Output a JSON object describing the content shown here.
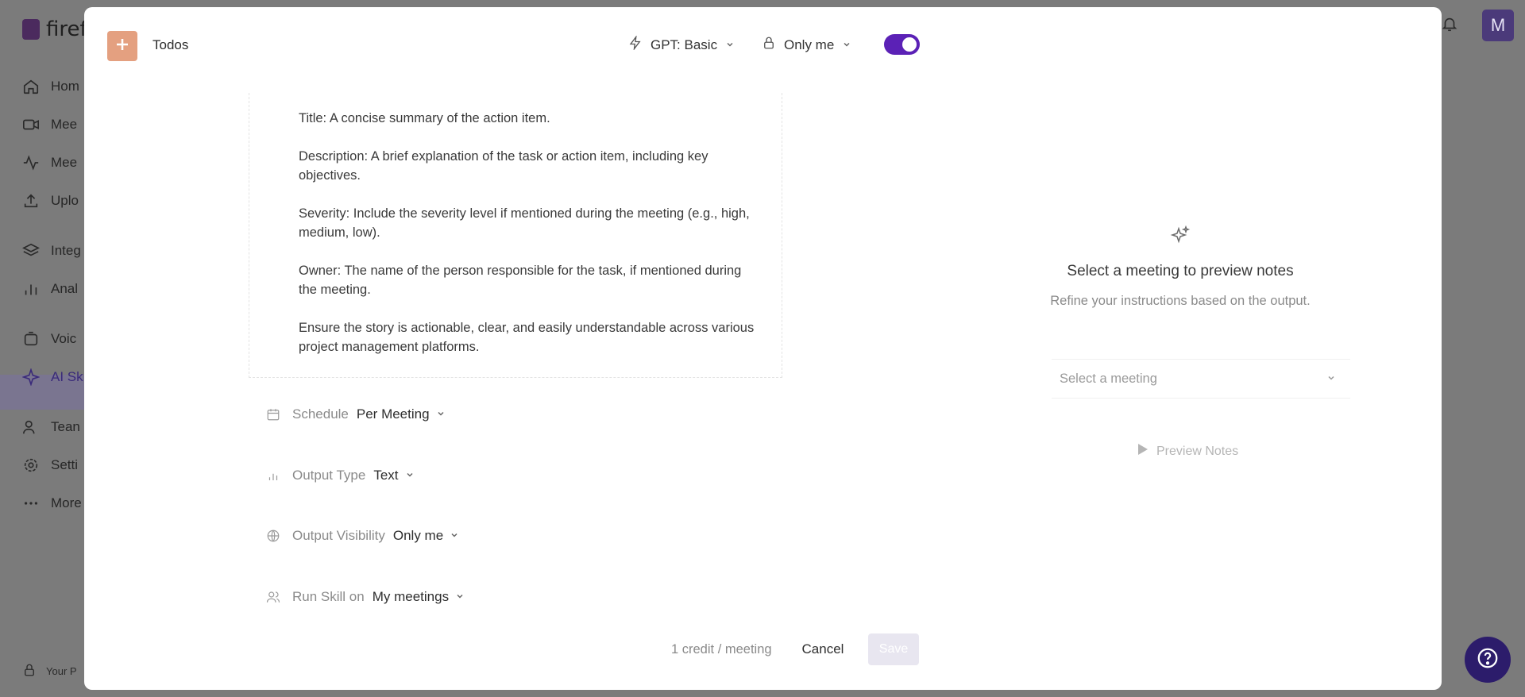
{
  "background": {
    "logo_text": "firef",
    "nav": [
      {
        "label": "Hom",
        "icon": "home-icon"
      },
      {
        "label": "Mee",
        "icon": "video-icon"
      },
      {
        "label": "Mee",
        "icon": "activity-icon"
      },
      {
        "label": "Uplo",
        "icon": "upload-icon"
      },
      {
        "label": "Integ",
        "icon": "layers-icon"
      },
      {
        "label": "Anal",
        "icon": "bar-chart-icon"
      },
      {
        "label": "Voic",
        "icon": "voice-icon"
      },
      {
        "label": "AI Sk",
        "icon": "sparkle-icon"
      },
      {
        "label": "Tean",
        "icon": "team-icon"
      },
      {
        "label": "Setti",
        "icon": "gear-icon"
      },
      {
        "label": "More",
        "icon": "more-icon"
      }
    ],
    "avatar_initial": "M",
    "footer_text": "Your P"
  },
  "modal": {
    "title": "Todos",
    "model": "GPT: Basic",
    "privacy": "Only me",
    "enabled": true,
    "prompt_paragraphs": [
      "Title: A concise summary of the action item.",
      "Description: A brief explanation of the task or action item, including key objectives.",
      "Severity: Include the severity level if mentioned during the meeting (e.g., high, medium, low).",
      "Owner: The name of the person responsible for the task, if mentioned during the meeting.",
      "Ensure the story is actionable, clear, and easily understandable across various project management platforms."
    ],
    "settings": {
      "schedule": {
        "label": "Schedule",
        "value": "Per Meeting"
      },
      "output_type": {
        "label": "Output Type",
        "value": "Text"
      },
      "output_visibility": {
        "label": "Output Visibility",
        "value": "Only me"
      },
      "run_skill_on": {
        "label": "Run Skill on",
        "value": "My meetings"
      }
    },
    "preview": {
      "title": "Select a meeting to preview notes",
      "subtitle": "Refine your instructions based on the output.",
      "select_placeholder": "Select a meeting",
      "button": "Preview Notes"
    },
    "footer": {
      "credit": "1 credit / meeting",
      "cancel": "Cancel",
      "save": "Save"
    }
  },
  "colors": {
    "accent": "#5b21b6",
    "badge": "#e4a080"
  }
}
